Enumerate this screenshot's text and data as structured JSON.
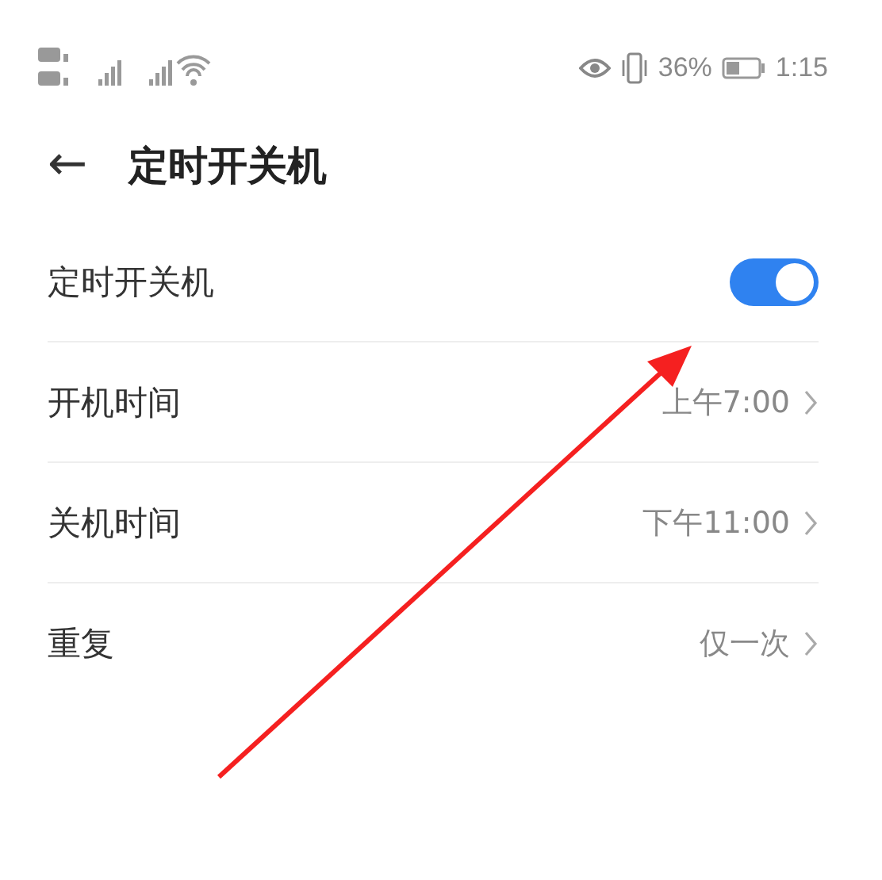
{
  "status_bar": {
    "battery": "36%",
    "time": "1:15"
  },
  "header": {
    "back": "←",
    "title": "定时开关机"
  },
  "rows": [
    {
      "kind": "toggle",
      "label": "定时开关机",
      "on": true
    },
    {
      "kind": "link",
      "label": "开机时间",
      "value": "上午7:00"
    },
    {
      "kind": "link",
      "label": "关机时间",
      "value": "下午11:00"
    },
    {
      "kind": "link",
      "label": "重复",
      "value": "仅一次"
    }
  ]
}
